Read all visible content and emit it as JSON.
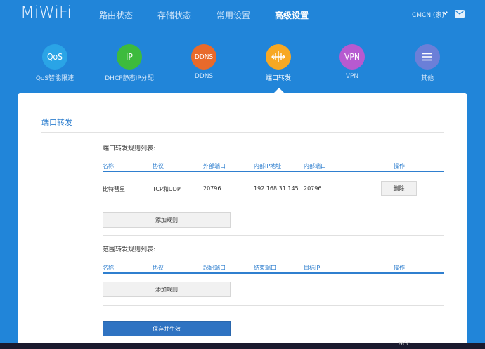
{
  "header": {
    "logo": "MiWiFi",
    "nav": [
      "路由状态",
      "存储状态",
      "常用设置",
      "高级设置"
    ],
    "active_nav": "高级设置",
    "user": "CMCN (家)"
  },
  "tools": [
    {
      "icon_text": "QoS",
      "label": "QoS智能限速",
      "color": "#2aa4e6"
    },
    {
      "icon_text": "IP",
      "label": "DHCP静态IP分配",
      "color": "#3dbb3d"
    },
    {
      "icon_text": "DDNS",
      "label": "DDNS",
      "color": "#e86a2b"
    },
    {
      "icon_text": "",
      "label": "端口转发",
      "color": "#f7a823"
    },
    {
      "icon_text": "VPN",
      "label": "VPN",
      "color": "#b65ad0"
    },
    {
      "icon_text": "",
      "label": "其他",
      "color": "#6b7fd8"
    }
  ],
  "panel": {
    "title": "端口转发",
    "port_rules": {
      "title": "端口转发规则列表:",
      "headers": [
        "名称",
        "协议",
        "外部端口",
        "内部IP地址",
        "内部端口",
        "操作"
      ],
      "rows": [
        {
          "name": "比特彗星",
          "protocol": "TCP和UDP",
          "ext_port": "20796",
          "ip": "192.168.31.145",
          "int_port": "20796",
          "action": "删除"
        }
      ],
      "add_label": "添加规则"
    },
    "range_rules": {
      "title": "范围转发规则列表:",
      "headers": [
        "名称",
        "协议",
        "起始端口",
        "结束端口",
        "目标IP",
        "操作"
      ],
      "add_label": "添加规则"
    },
    "save_label": "保存并生效"
  },
  "taskbar": {
    "text": "26°C"
  }
}
